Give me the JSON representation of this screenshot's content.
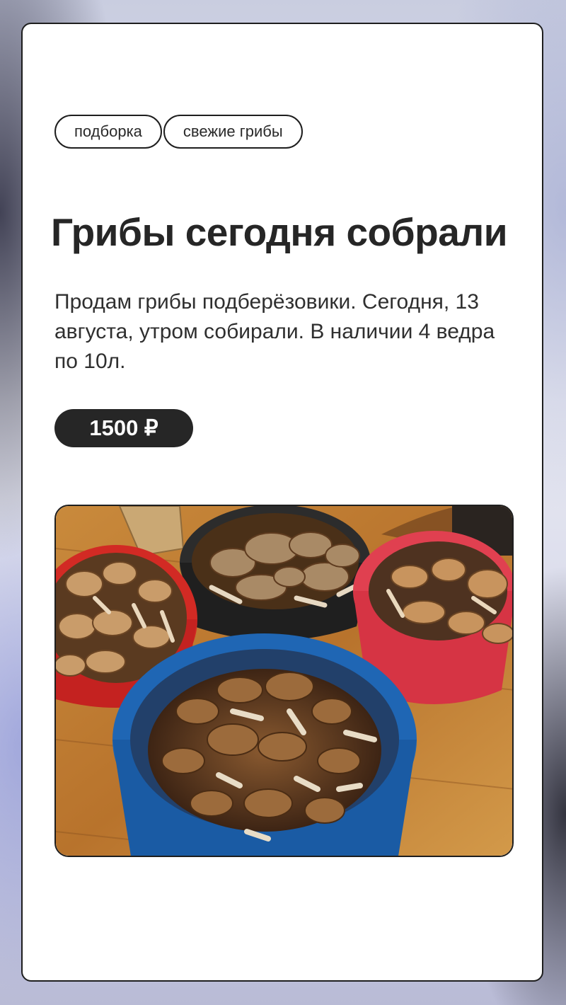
{
  "post": {
    "tags": [
      "подборка",
      "свежие грибы"
    ],
    "title": "Грибы сегодня собрали",
    "description": "Продам грибы подберёзовики. Сегодня, 13 августа, утром собирали. В наличии 4 ведра по 10л.",
    "price": "1500 ₽"
  },
  "colors": {
    "card_border": "#1e1e1e",
    "price_badge": "#262626",
    "text": "#262626"
  }
}
